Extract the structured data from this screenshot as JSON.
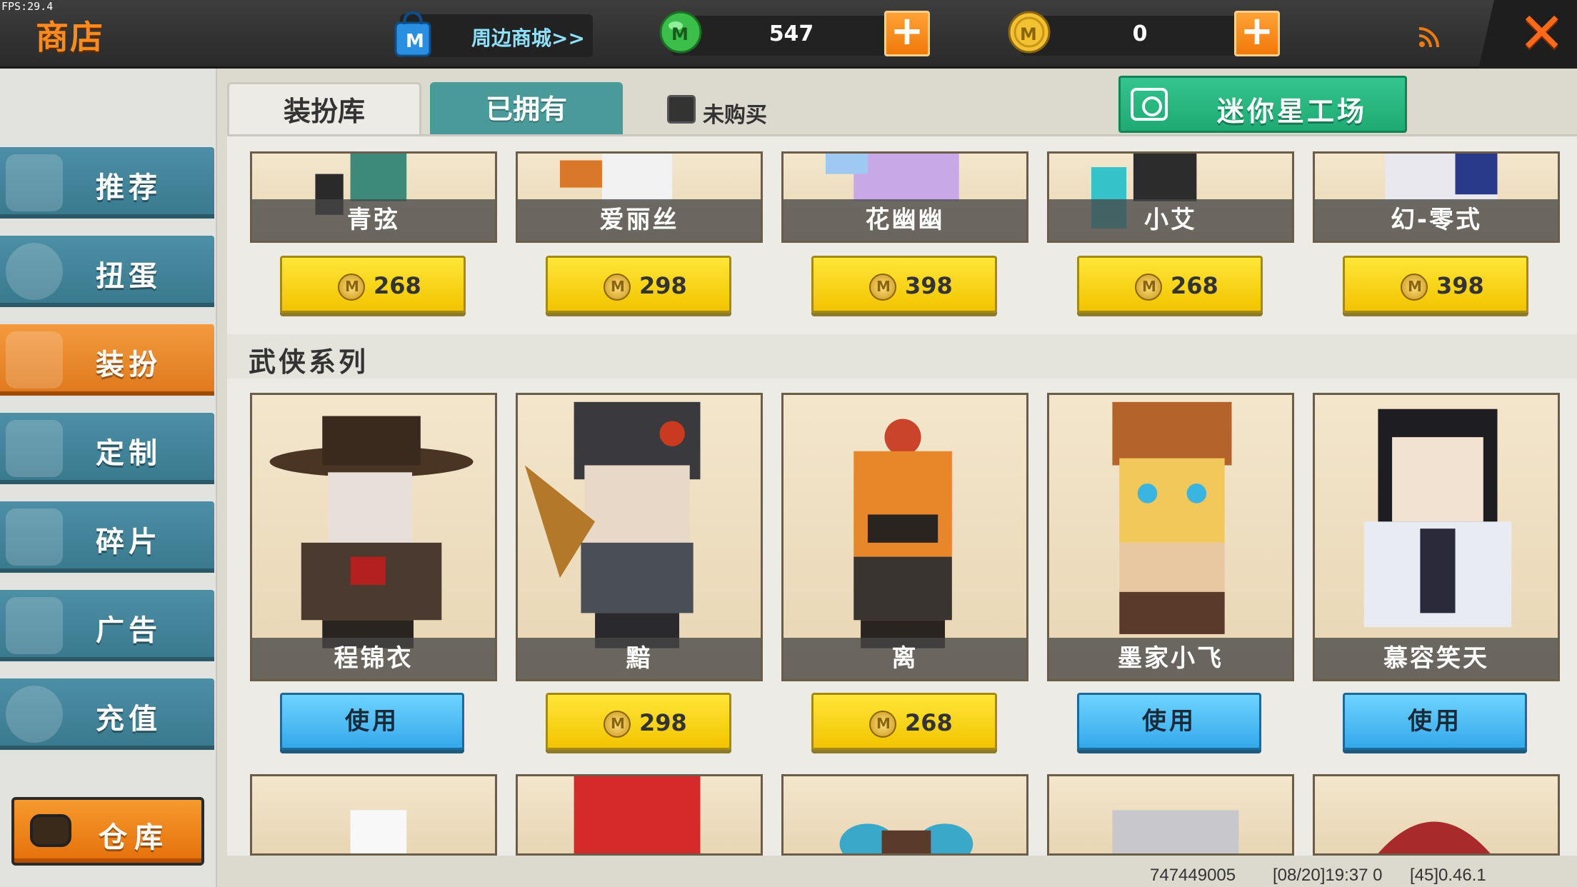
{
  "fps": "FPS:29.4",
  "header": {
    "title": "商店",
    "mall_label": "周边商城>>",
    "mini_beans": "547",
    "mini_coins": "0",
    "icons": {
      "mall": "shopping-bag-icon",
      "beans": "green-mini-bean-icon",
      "coins": "gold-mini-coin-icon",
      "signal": "signal-icon",
      "close": "close-icon"
    },
    "colors": {
      "accent": "#ff8a1e",
      "plus": "#f07a0a"
    }
  },
  "sidebar": {
    "items": [
      {
        "label": "推荐",
        "icon": "thumbs-up-icon",
        "active": false
      },
      {
        "label": "扭蛋",
        "icon": "gacha-ball-icon",
        "active": false
      },
      {
        "label": "装扮",
        "icon": "outfit-shirt-icon",
        "active": true
      },
      {
        "label": "定制",
        "icon": "pencil-icon",
        "active": false
      },
      {
        "label": "碎片",
        "icon": "puzzle-piece-icon",
        "active": false
      },
      {
        "label": "广告",
        "icon": "gift-box-icon",
        "active": false
      },
      {
        "label": "充值",
        "icon": "coins-icon",
        "active": false
      }
    ],
    "depot_label": "仓库",
    "colors": {
      "item": "#3a7a8f",
      "active": "#e07a1e"
    }
  },
  "tabs": {
    "wardrobe": "装扮库",
    "owned": "已拥有",
    "unpurchased_filter": "未购买",
    "workshop_button": "迷你星工场"
  },
  "top_row": [
    {
      "name": "青弦",
      "price": "268"
    },
    {
      "name": "爱丽丝",
      "price": "298"
    },
    {
      "name": "花幽幽",
      "price": "398"
    },
    {
      "name": "小艾",
      "price": "268"
    },
    {
      "name": "幻-零式",
      "price": "398"
    }
  ],
  "series": {
    "title": "武侠系列",
    "items": [
      {
        "name": "程锦衣",
        "action": "使用"
      },
      {
        "name": "黯",
        "price": "298"
      },
      {
        "name": "离",
        "price": "268"
      },
      {
        "name": "墨家小飞",
        "action": "使用"
      },
      {
        "name": "慕容笑天",
        "action": "使用"
      }
    ]
  },
  "footer": {
    "uin": "747449005",
    "time": "[08/20]19:37 0",
    "version": "[45]0.46.1"
  }
}
